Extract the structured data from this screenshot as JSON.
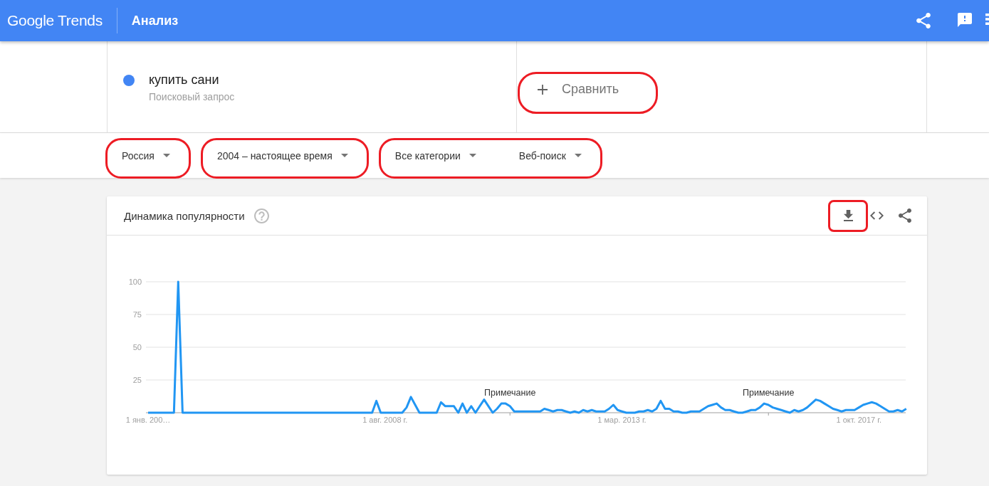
{
  "header": {
    "logo": "Google Trends",
    "title": "Анализ",
    "actions": [
      {
        "kind": "share"
      },
      {
        "kind": "feedback"
      },
      {
        "kind": "more"
      }
    ]
  },
  "terms": [
    {
      "term": "купить сани",
      "type": "Поисковый запрос",
      "color": "#4285f4"
    }
  ],
  "compare": {
    "label": "Сравнить",
    "highlighted": true
  },
  "filter_groups": [
    {
      "highlighted": true,
      "filters": [
        {
          "label": "Россия"
        }
      ]
    },
    {
      "highlighted": true,
      "filters": [
        {
          "label": "2004 – настоящее время"
        }
      ]
    },
    {
      "highlighted": true,
      "filters": [
        {
          "label": "Все категории"
        },
        {
          "label": "Веб-поиск"
        }
      ]
    }
  ],
  "interest_card": {
    "title": "Динамика популярности",
    "actions": [
      {
        "kind": "download",
        "highlighted": true
      },
      {
        "kind": "embed",
        "highlighted": false
      },
      {
        "kind": "share",
        "highlighted": false
      }
    ],
    "chart_data": {
      "type": "line",
      "grid": true,
      "categories": [
        "1 янв. 200…",
        null,
        null,
        null,
        null,
        null,
        null,
        null,
        null,
        null,
        null,
        null,
        null,
        null,
        null,
        null,
        null,
        null,
        null,
        null,
        null,
        null,
        null,
        null,
        null,
        null,
        null,
        null,
        null,
        null,
        null,
        null,
        null,
        null,
        null,
        null,
        null,
        null,
        null,
        null,
        null,
        null,
        null,
        null,
        null,
        null,
        null,
        null,
        null,
        null,
        null,
        null,
        null,
        null,
        null,
        "1 авг. 2008 г.",
        null,
        null,
        null,
        null,
        null,
        null,
        null,
        null,
        null,
        null,
        null,
        null,
        null,
        null,
        null,
        null,
        null,
        null,
        null,
        null,
        null,
        null,
        null,
        null,
        null,
        null,
        null,
        null,
        null,
        null,
        null,
        null,
        null,
        null,
        null,
        null,
        null,
        null,
        null,
        null,
        null,
        null,
        null,
        null,
        null,
        null,
        null,
        null,
        null,
        null,
        null,
        null,
        null,
        null,
        "1 мар. 2013 г.",
        null,
        null,
        null,
        null,
        null,
        null,
        null,
        null,
        null,
        null,
        null,
        null,
        null,
        null,
        null,
        null,
        null,
        null,
        null,
        null,
        null,
        null,
        null,
        null,
        null,
        null,
        null,
        null,
        null,
        null,
        null,
        null,
        null,
        null,
        null,
        null,
        null,
        null,
        null,
        null,
        null,
        null,
        null,
        null,
        null,
        null,
        null,
        null,
        null,
        null,
        null,
        null,
        null,
        null,
        "1 окт. 2017 г.",
        null,
        null,
        null,
        null,
        null,
        null,
        null,
        null,
        null,
        null,
        null
      ],
      "ylim": [
        0,
        100
      ],
      "yticks": [
        25,
        50,
        75,
        100
      ],
      "series": [
        {
          "color": "#2196f3",
          "values": [
            0,
            0,
            0,
            0,
            0,
            0,
            0,
            100,
            0,
            0,
            0,
            0,
            0,
            0,
            0,
            0,
            0,
            0,
            0,
            0,
            0,
            0,
            0,
            0,
            0,
            0,
            0,
            0,
            0,
            0,
            0,
            0,
            0,
            0,
            0,
            0,
            0,
            0,
            0,
            0,
            0,
            0,
            0,
            0,
            0,
            0,
            0,
            0,
            0,
            0,
            0,
            0,
            0,
            9,
            0,
            0,
            0,
            0,
            0,
            0,
            4,
            12,
            6,
            0,
            0,
            0,
            0,
            0,
            8,
            5,
            5,
            5,
            0,
            7,
            0,
            5,
            0,
            5,
            10,
            5,
            0,
            3,
            7,
            7,
            5,
            1,
            1,
            1,
            1,
            1,
            1,
            1,
            3,
            2,
            1,
            2,
            2,
            1,
            0,
            1,
            0,
            2,
            1,
            2,
            1,
            1,
            1,
            3,
            6,
            2,
            1,
            0,
            0,
            0,
            1,
            1,
            2,
            1,
            3,
            9,
            3,
            3,
            1,
            1,
            0,
            0,
            1,
            1,
            1,
            3,
            5,
            6,
            7,
            4,
            2,
            2,
            1,
            0,
            0,
            1,
            2,
            2,
            4,
            7,
            6,
            4,
            3,
            2,
            1,
            0,
            2,
            1,
            2,
            4,
            7,
            10,
            9,
            7,
            5,
            3,
            2,
            1,
            2,
            2,
            2,
            4,
            6,
            7,
            8,
            7,
            5,
            3,
            1,
            1,
            2,
            1,
            3
          ]
        }
      ],
      "annotations": [
        {
          "text": "Примечание"
        },
        {
          "text": "Примечание"
        }
      ]
    }
  }
}
